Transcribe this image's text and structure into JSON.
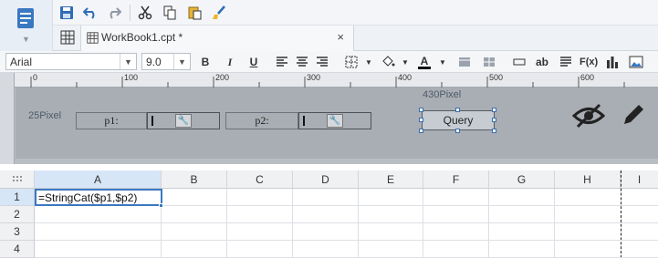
{
  "tab": {
    "title": "WorkBook1.cpt *",
    "close": "×"
  },
  "format": {
    "font": "Arial",
    "size": "9.0",
    "bold": "B",
    "italic": "I",
    "underline": "U",
    "ab": "ab",
    "fx": "F(x)"
  },
  "ruler": {
    "ticks": [
      "0",
      "100",
      "200",
      "300",
      "400",
      "500",
      "600"
    ]
  },
  "params": {
    "height_label": "25Pixel",
    "width_label": "430Pixel",
    "p1_label": "p1:",
    "p2_label": "p2:",
    "query_label": "Query"
  },
  "sheet": {
    "columns": [
      "A",
      "B",
      "C",
      "D",
      "E",
      "F",
      "G",
      "H",
      "I"
    ],
    "rows": [
      "1",
      "2",
      "3",
      "4"
    ],
    "selected_cell_value": "=StringCat($p1,$p2)"
  },
  "colors": {
    "accent": "#3a78c2",
    "selected_header": "#d7e6f7"
  }
}
